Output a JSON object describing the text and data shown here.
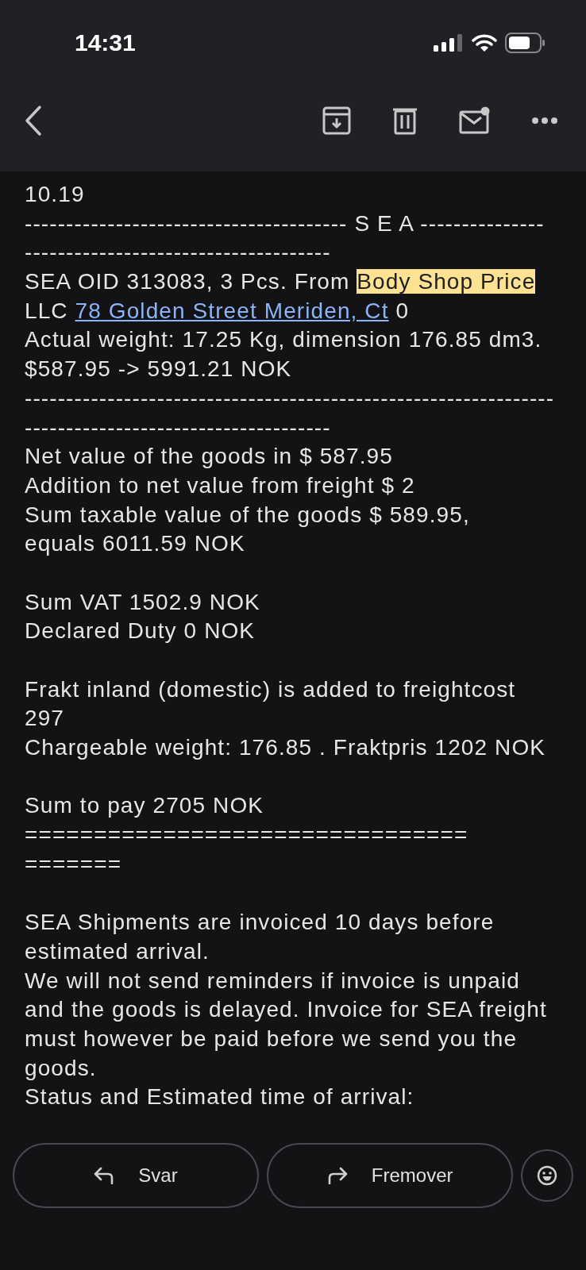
{
  "status_bar": {
    "time": "14:31"
  },
  "paragraphs": [
    {
      "lines": [
        {
          "segments": [
            {
              "kind": "plain",
              "text": "10.19"
            }
          ]
        },
        {
          "segments": [
            {
              "kind": "plain",
              "text": "--------------------------------------- S E A ---------------"
            }
          ]
        },
        {
          "segments": [
            {
              "kind": "plain",
              "text": "-------------------------------------"
            }
          ]
        },
        {
          "segments": [
            {
              "kind": "plain",
              "text": "SEA OID 313083, 3 Pcs. From "
            },
            {
              "kind": "highlight",
              "text": "Body Shop Price"
            }
          ]
        },
        {
          "segments": [
            {
              "kind": "plain",
              "text": "LLC "
            },
            {
              "kind": "link",
              "text": "78 Golden Street Meriden, Ct"
            },
            {
              "kind": "plain",
              "text": " 0"
            }
          ]
        },
        {
          "segments": [
            {
              "kind": "plain",
              "text": "Actual weight: 17.25 Kg, dimension 176.85 dm3."
            }
          ]
        },
        {
          "segments": [
            {
              "kind": "plain",
              "text": "$587.95 -> 5991.21 NOK"
            }
          ]
        },
        {
          "segments": [
            {
              "kind": "plain",
              "text": "----------------------------------------------------------------"
            }
          ]
        },
        {
          "segments": [
            {
              "kind": "plain",
              "text": "-------------------------------------"
            }
          ]
        },
        {
          "segments": [
            {
              "kind": "plain",
              "text": "Net value of the goods in $ 587.95"
            }
          ]
        },
        {
          "segments": [
            {
              "kind": "plain",
              "text": "Addition to net value from freight $ 2"
            }
          ]
        },
        {
          "segments": [
            {
              "kind": "plain",
              "text": "Sum taxable value of the goods $ 589.95,"
            }
          ]
        },
        {
          "segments": [
            {
              "kind": "plain",
              "text": "equals 6011.59 NOK"
            }
          ]
        }
      ]
    },
    {
      "lines": [
        {
          "segments": [
            {
              "kind": "plain",
              "text": "Sum VAT 1502.9 NOK"
            }
          ]
        },
        {
          "segments": [
            {
              "kind": "plain",
              "text": "Declared Duty 0 NOK"
            }
          ]
        }
      ]
    },
    {
      "lines": [
        {
          "segments": [
            {
              "kind": "plain",
              "text": "Frakt inland (domestic) is added to freightcost"
            }
          ]
        },
        {
          "segments": [
            {
              "kind": "plain",
              "text": "297"
            }
          ]
        },
        {
          "segments": [
            {
              "kind": "plain",
              "text": "Chargeable weight: 176.85 . Fraktpris 1202 NOK"
            }
          ]
        }
      ]
    },
    {
      "lines": [
        {
          "segments": [
            {
              "kind": "plain",
              "text": "Sum to pay 2705 NOK"
            }
          ]
        },
        {
          "segments": [
            {
              "kind": "plain",
              "text": "================================"
            }
          ]
        },
        {
          "segments": [
            {
              "kind": "plain",
              "text": "======="
            }
          ]
        }
      ]
    },
    {
      "lines": [
        {
          "segments": [
            {
              "kind": "plain",
              "text": "SEA Shipments are invoiced 10 days before"
            }
          ]
        },
        {
          "segments": [
            {
              "kind": "plain",
              "text": "estimated arrival."
            }
          ]
        },
        {
          "segments": [
            {
              "kind": "plain",
              "text": "We will not send reminders if invoice is unpaid"
            }
          ]
        },
        {
          "segments": [
            {
              "kind": "plain",
              "text": "and the goods is delayed. Invoice for SEA freight"
            }
          ]
        },
        {
          "segments": [
            {
              "kind": "plain",
              "text": "must however be paid before we send you the"
            }
          ]
        },
        {
          "segments": [
            {
              "kind": "plain",
              "text": "goods."
            }
          ]
        },
        {
          "segments": [
            {
              "kind": "plain",
              "text": "Status and Estimated time of arrival:"
            }
          ]
        }
      ]
    }
  ],
  "actions": [
    {
      "kind": "reply",
      "label": "Svar"
    },
    {
      "kind": "forward",
      "label": "Fremover"
    }
  ]
}
